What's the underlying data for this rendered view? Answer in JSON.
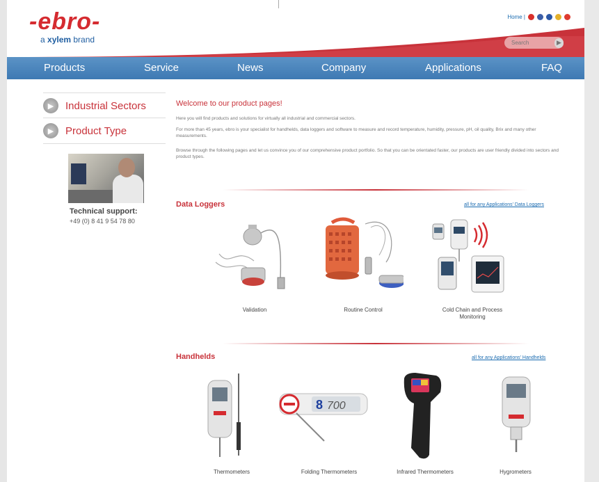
{
  "brand": {
    "logo_text": "-ebro-",
    "tagline_prefix": "a ",
    "tagline_brand": "xylem",
    "tagline_suffix": " brand"
  },
  "topbar": {
    "home_label": "Home |"
  },
  "search": {
    "placeholder": "Search",
    "button_glyph": "▶"
  },
  "nav": {
    "items": [
      "Products",
      "Service",
      "News",
      "Company",
      "Applications",
      "FAQ"
    ]
  },
  "sidebar": {
    "items": [
      "Industrial Sectors",
      "Product Type"
    ],
    "support_title": "Technical support:",
    "support_phone": "+49 (0) 8 41 9 54 78 80"
  },
  "intro": {
    "title": "Welcome to our product pages!",
    "p1": "Here you will find products and solutions for virtually all industrial and commercial sectors.",
    "p2": "For more than 45 years, ebro is your specialist for handhelds, data loggers and software to measure and record temperature, humidity, pressure, pH, oil quality, Brix and many other measurements.",
    "p3": "Browse through the following pages and let us convince you of our comprehensive product portfolio. So that you can be orientated faster, our products are user friendly divided into sectors and product types."
  },
  "sections": [
    {
      "title": "Data Loggers",
      "link": "all for any Applications' Data Loggers",
      "products": [
        "Validation",
        "Routine Control",
        "Cold Chain and Process Monitoring"
      ]
    },
    {
      "title": "Handhelds",
      "link": "all for any Applications' Handhelds",
      "products": [
        "Thermometers",
        "Folding Thermometers",
        "Infrared Thermometers",
        "Hygrometers"
      ]
    }
  ],
  "colors": {
    "brand_red": "#c8323a",
    "nav_blue": "#4a83bc",
    "link_blue": "#1a6bb0"
  }
}
